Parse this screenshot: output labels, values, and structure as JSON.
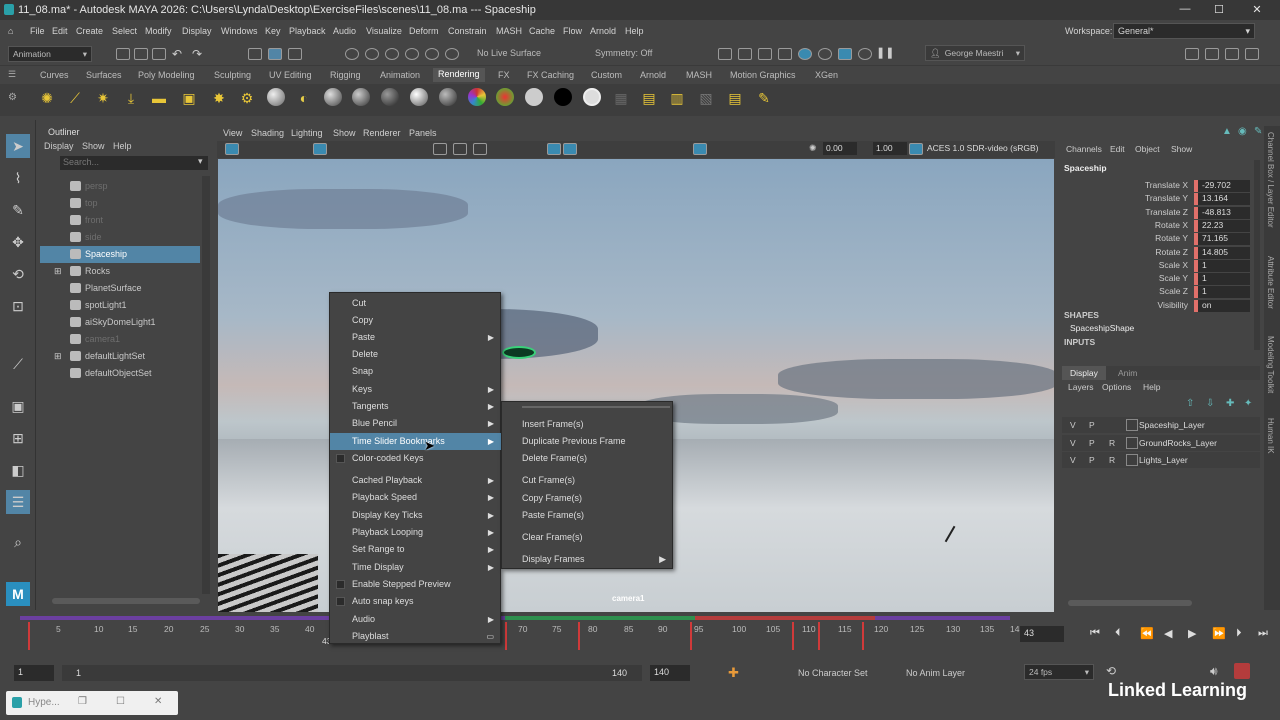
{
  "titlebar": {
    "title": "11_08.ma* - Autodesk MAYA 2026: C:\\Users\\Lynda\\Desktop\\ExerciseFiles\\scenes\\11_08.ma   ---   Spaceship"
  },
  "menubar": [
    "File",
    "Edit",
    "Create",
    "Select",
    "Modify",
    "Display",
    "Windows",
    "Key",
    "Playback",
    "Audio",
    "Visualize",
    "Deform",
    "Constrain",
    "MASH",
    "Cache",
    "Flow",
    "Arnold",
    "Help"
  ],
  "workspace": {
    "label": "Workspace:",
    "value": "General*"
  },
  "toolbar": {
    "menuset": "Animation",
    "live_surface": "No Live Surface",
    "symmetry": "Symmetry: Off",
    "user": "George Maestri"
  },
  "shelf_tabs": [
    "Curves",
    "Surfaces",
    "Poly Modeling",
    "Sculpting",
    "UV Editing",
    "Rigging",
    "Animation",
    "Rendering",
    "FX",
    "FX Caching",
    "Custom",
    "Arnold",
    "MASH",
    "Motion Graphics",
    "XGen"
  ],
  "active_shelf_tab": "Rendering",
  "outliner": {
    "title": "Outliner",
    "menu": [
      "Display",
      "Show",
      "Help"
    ],
    "search_placeholder": "Search...",
    "items": [
      {
        "label": "persp",
        "dim": true,
        "icon": "camera-icon"
      },
      {
        "label": "top",
        "dim": true,
        "icon": "camera-icon"
      },
      {
        "label": "front",
        "dim": true,
        "icon": "camera-icon"
      },
      {
        "label": "side",
        "dim": true,
        "icon": "camera-icon"
      },
      {
        "label": "Spaceship",
        "selected": true,
        "icon": "mesh-icon"
      },
      {
        "label": "Rocks",
        "expandable": true,
        "icon": "mesh-icon"
      },
      {
        "label": "PlanetSurface",
        "icon": "mesh-icon"
      },
      {
        "label": "spotLight1",
        "icon": "light-icon"
      },
      {
        "label": "aiSkyDomeLight1",
        "icon": "light-icon"
      },
      {
        "label": "camera1",
        "dim": true,
        "icon": "camera-icon"
      },
      {
        "label": "defaultLightSet",
        "expandable": true,
        "icon": "set-icon"
      },
      {
        "label": "defaultObjectSet",
        "icon": "set-icon"
      }
    ]
  },
  "viewport": {
    "menu": [
      "View",
      "Shading",
      "Lighting",
      "Show",
      "Renderer",
      "Panels"
    ],
    "exposure": "0.00",
    "gamma": "1.00",
    "colorspace": "ACES 1.0 SDR-video (sRGB)",
    "camera_label": "camera1"
  },
  "context_menu": {
    "items": [
      {
        "label": "Cut"
      },
      {
        "label": "Copy"
      },
      {
        "label": "Paste",
        "sub": true
      },
      {
        "label": "Delete"
      },
      {
        "label": "Snap"
      },
      {
        "label": "Keys",
        "sub": true
      },
      {
        "label": "Tangents",
        "sub": true
      },
      {
        "label": "Blue Pencil",
        "sub": true
      },
      {
        "label": "Time Slider Bookmarks",
        "sub": true,
        "highlight": true
      },
      {
        "label": "Color-coded Keys",
        "check": true
      },
      {
        "label": "Cached Playback",
        "sub": true
      },
      {
        "label": "Playback Speed",
        "sub": true
      },
      {
        "label": "Display Key Ticks",
        "sub": true
      },
      {
        "label": "Playback Looping",
        "sub": true
      },
      {
        "label": "Set Range to",
        "sub": true
      },
      {
        "label": "Time Display",
        "sub": true
      },
      {
        "label": "Enable Stepped Preview",
        "check": true
      },
      {
        "label": "Auto snap keys",
        "check": true
      },
      {
        "label": "Audio",
        "sub": true
      },
      {
        "label": "Playblast",
        "box": true
      }
    ]
  },
  "submenu": {
    "items": [
      "Insert Frame(s)",
      "Duplicate Previous Frame",
      "Delete Frame(s)",
      "Cut Frame(s)",
      "Copy Frame(s)",
      "Paste Frame(s)",
      "Clear Frame(s)",
      "Display Frames"
    ]
  },
  "channel_box": {
    "menu": [
      "Channels",
      "Edit",
      "Object",
      "Show"
    ],
    "object": "Spaceship",
    "attrs": [
      {
        "name": "Translate X",
        "value": "-29.702"
      },
      {
        "name": "Translate Y",
        "value": "13.164"
      },
      {
        "name": "Translate Z",
        "value": "-48.813"
      },
      {
        "name": "Rotate X",
        "value": "22.23"
      },
      {
        "name": "Rotate Y",
        "value": "71.165"
      },
      {
        "name": "Rotate Z",
        "value": "14.805"
      },
      {
        "name": "Scale X",
        "value": "1"
      },
      {
        "name": "Scale Y",
        "value": "1"
      },
      {
        "name": "Scale Z",
        "value": "1"
      },
      {
        "name": "Visibility",
        "value": "on"
      }
    ],
    "shapes_label": "SHAPES",
    "shape_name": "SpaceshipShape",
    "inputs_label": "INPUTS",
    "layer_tabs": [
      "Display",
      "Anim"
    ],
    "layer_menu": [
      "Layers",
      "Options",
      "Help"
    ],
    "layers": [
      {
        "v": "V",
        "p": "P",
        "r": "",
        "name": "Spaceship_Layer"
      },
      {
        "v": "V",
        "p": "P",
        "r": "R",
        "name": "GroundRocks_Layer"
      },
      {
        "v": "V",
        "p": "P",
        "r": "R",
        "name": "Lights_Layer"
      }
    ]
  },
  "right_tabs": [
    "Channel Box / Layer Editor",
    "Attribute Editor",
    "Modeling Toolkit",
    "Human IK"
  ],
  "timeline": {
    "ticks": [
      "5",
      "10",
      "15",
      "20",
      "25",
      "30",
      "35",
      "40",
      "70",
      "75",
      "80",
      "85",
      "90",
      "95",
      "100",
      "105",
      "110",
      "115",
      "120",
      "125",
      "130",
      "135",
      "14"
    ],
    "current_frame": "43",
    "current_marker": "43"
  },
  "range": {
    "start": "1",
    "inner_start": "1",
    "inner_end": "140",
    "end": "140",
    "character_set": "No Character Set",
    "anim_layer": "No Anim Layer",
    "fps": "24 fps"
  },
  "taskbar": {
    "app": "Hype..."
  },
  "watermark": "Linked Learning",
  "colors": {
    "accent": "#5285a6",
    "selected": "#5285a6",
    "key_red": "#e0706a"
  }
}
